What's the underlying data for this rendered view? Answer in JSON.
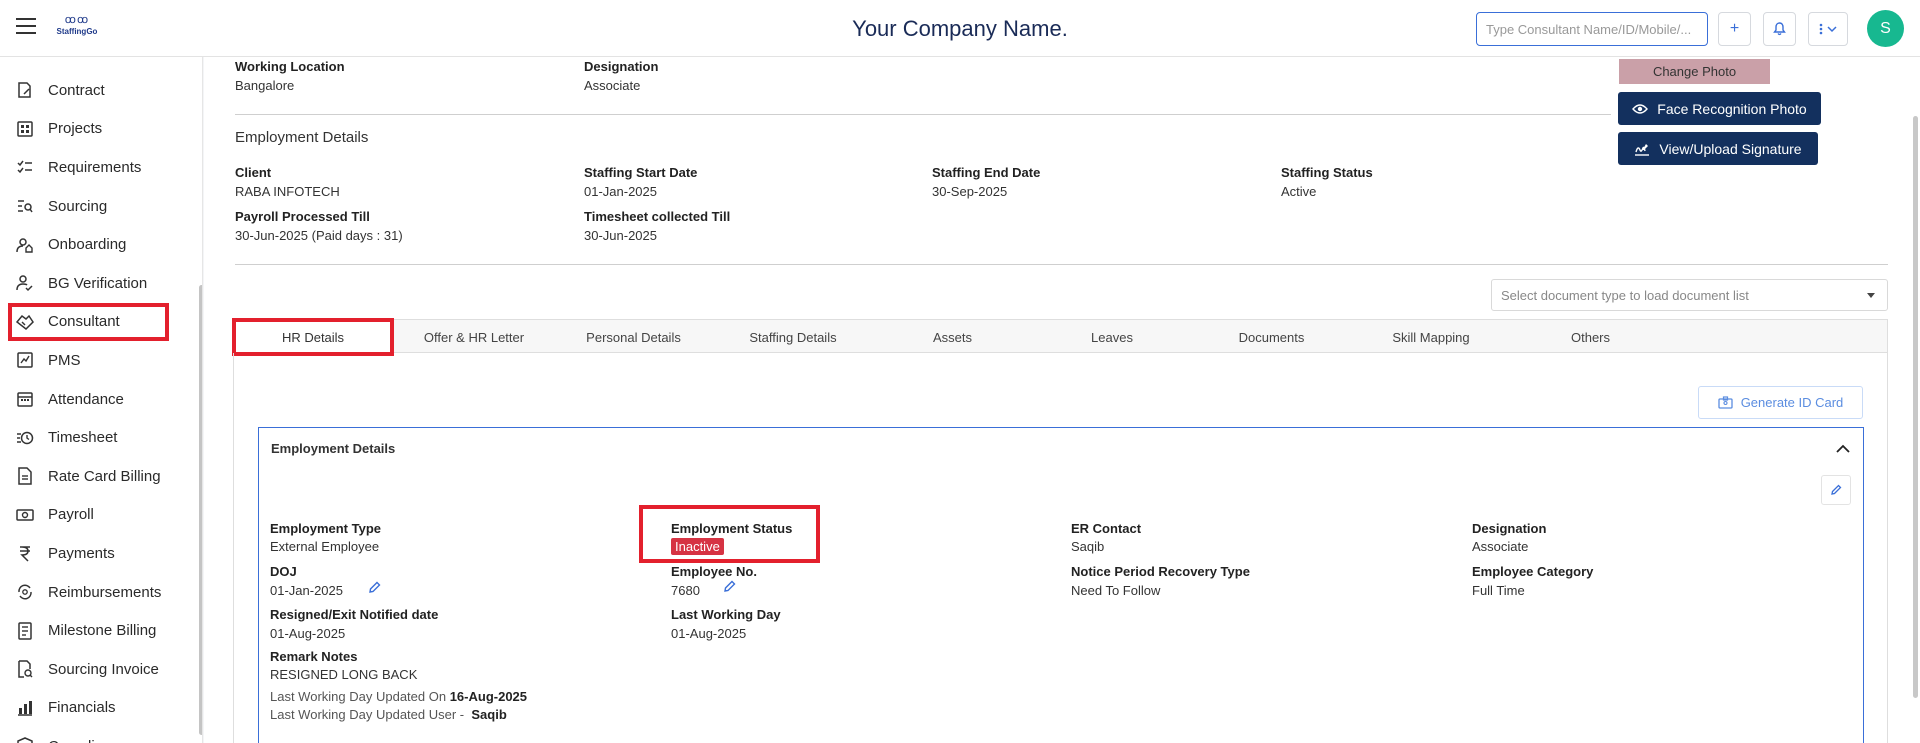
{
  "header": {
    "logo_text": "StaffingGo",
    "company_name": "Your Company Name.",
    "search_placeholder": "Type Consultant Name/ID/Mobile/...",
    "avatar_letter": "S"
  },
  "sidebar": {
    "items": [
      {
        "label": "Contract",
        "icon": "contract-icon"
      },
      {
        "label": "Projects",
        "icon": "grid-icon"
      },
      {
        "label": "Requirements",
        "icon": "checklist-icon"
      },
      {
        "label": "Sourcing",
        "icon": "search-list-icon"
      },
      {
        "label": "Onboarding",
        "icon": "user-home-icon"
      },
      {
        "label": "BG Verification",
        "icon": "user-check-icon"
      },
      {
        "label": "Consultant",
        "icon": "handshake-icon"
      },
      {
        "label": "PMS",
        "icon": "chart-box-icon"
      },
      {
        "label": "Attendance",
        "icon": "calendar-icon"
      },
      {
        "label": "Timesheet",
        "icon": "clock-list-icon"
      },
      {
        "label": "Rate Card Billing",
        "icon": "document-icon"
      },
      {
        "label": "Payroll",
        "icon": "money-icon"
      },
      {
        "label": "Payments",
        "icon": "rupee-icon"
      },
      {
        "label": "Reimbursements",
        "icon": "refresh-money-icon"
      },
      {
        "label": "Milestone Billing",
        "icon": "document-lines-icon"
      },
      {
        "label": "Sourcing Invoice",
        "icon": "invoice-search-icon"
      },
      {
        "label": "Financials",
        "icon": "bar-chart-icon"
      },
      {
        "label": "Compliance",
        "icon": "shield-icon"
      }
    ],
    "active": "Consultant"
  },
  "top_info": {
    "working_location_label": "Working Location",
    "working_location": "Bangalore",
    "designation_label": "Designation",
    "designation": "Associate"
  },
  "photo": {
    "change_photo": "Change Photo",
    "face_recognition": "Face Recognition Photo",
    "view_upload_signature": "View/Upload Signature"
  },
  "employment_summary": {
    "title": "Employment Details",
    "client_label": "Client",
    "client": "RABA INFOTECH",
    "staffing_start_label": "Staffing Start Date",
    "staffing_start": "01-Jan-2025",
    "staffing_end_label": "Staffing End Date",
    "staffing_end": "30-Sep-2025",
    "staffing_status_label": "Staffing Status",
    "staffing_status": "Active",
    "payroll_label": "Payroll Processed Till",
    "payroll": "30-Jun-2025 (Paid days : 31)",
    "timesheet_label": "Timesheet collected Till",
    "timesheet": "30-Jun-2025"
  },
  "document_select_placeholder": "Select document type to load document list",
  "tabs": [
    "HR Details",
    "Offer & HR Letter",
    "Personal Details",
    "Staffing Details",
    "Assets",
    "Leaves",
    "Documents",
    "Skill Mapping",
    "Others"
  ],
  "generate_id_card": "Generate ID Card",
  "employment_card": {
    "title": "Employment Details",
    "employment_type_label": "Employment Type",
    "employment_type": "External Employee",
    "employment_status_label": "Employment Status",
    "employment_status": "Inactive",
    "er_contact_label": "ER Contact",
    "er_contact": "Saqib",
    "designation_label": "Designation",
    "designation": "Associate",
    "doj_label": "DOJ",
    "doj": "01-Jan-2025",
    "employee_no_label": "Employee No.",
    "employee_no": "7680",
    "notice_period_label": "Notice Period Recovery Type",
    "notice_period": "Need To Follow",
    "employee_category_label": "Employee Category",
    "employee_category": "Full Time",
    "resigned_label": "Resigned/Exit Notified date",
    "resigned": "01-Aug-2025",
    "last_working_label": "Last Working Day",
    "last_working": "01-Aug-2025",
    "remark_label": "Remark Notes",
    "remark": "RESIGNED LONG BACK",
    "lwd_updated_on_label": "Last Working Day Updated On",
    "lwd_updated_on": "16-Aug-2025",
    "lwd_updated_user_label": "Last Working Day Updated User -",
    "lwd_updated_user": "Saqib"
  }
}
